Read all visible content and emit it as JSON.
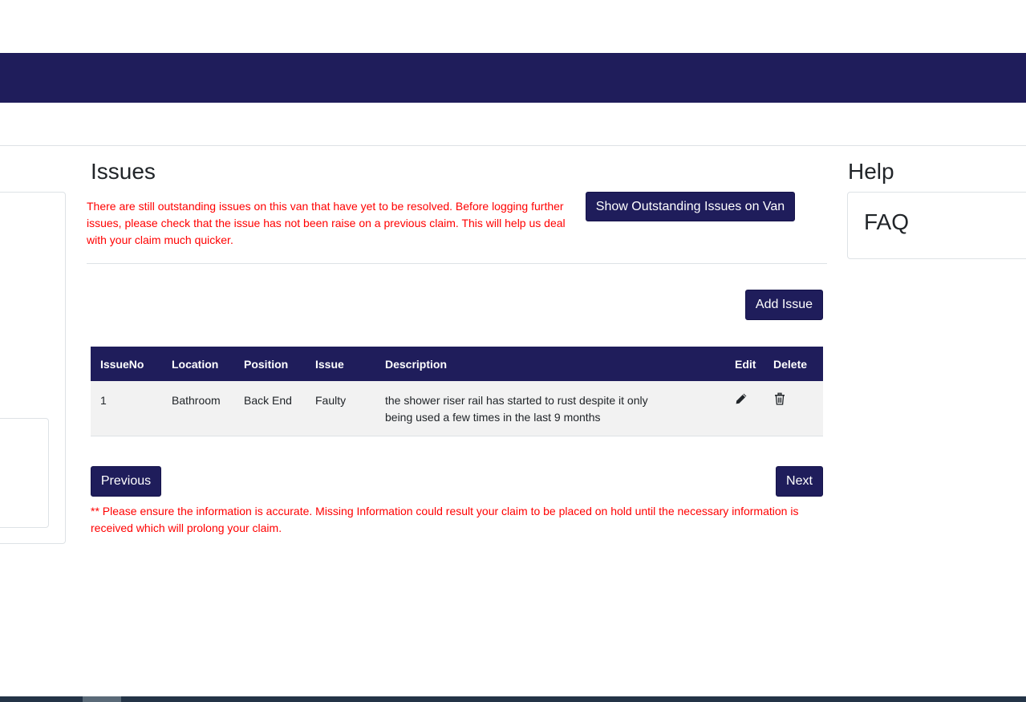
{
  "issues": {
    "title": "Issues",
    "warning": "There are still outstanding issues on this van that have yet to be resolved. Before logging further issues, please check that the issue has not been raise on a previous claim. This will help us deal with your claim much quicker.",
    "show_outstanding_label": "Show Outstanding Issues on Van",
    "add_issue_label": "Add Issue",
    "table": {
      "headers": [
        "IssueNo",
        "Location",
        "Position",
        "Issue",
        "Description",
        "Edit",
        "Delete"
      ],
      "rows": [
        {
          "issue_no": "1",
          "location": "Bathroom",
          "position": "Back End",
          "issue": "Faulty",
          "description": "the shower riser rail has started to rust despite it only being used a few times in the last 9 months",
          "edit_icon": "pencil-icon",
          "delete_icon": "trash-icon"
        }
      ]
    },
    "previous_label": "Previous",
    "next_label": "Next",
    "footer_note": "** Please ensure the information is accurate. Missing Information could result your claim to be placed on hold until the necessary information is received which will prolong your claim."
  },
  "help": {
    "title": "Help",
    "faq_label": "FAQ"
  },
  "colors": {
    "brand_navy": "#1f1d5b",
    "warning_red": "#ff0000",
    "row_background": "#f2f2f2"
  }
}
